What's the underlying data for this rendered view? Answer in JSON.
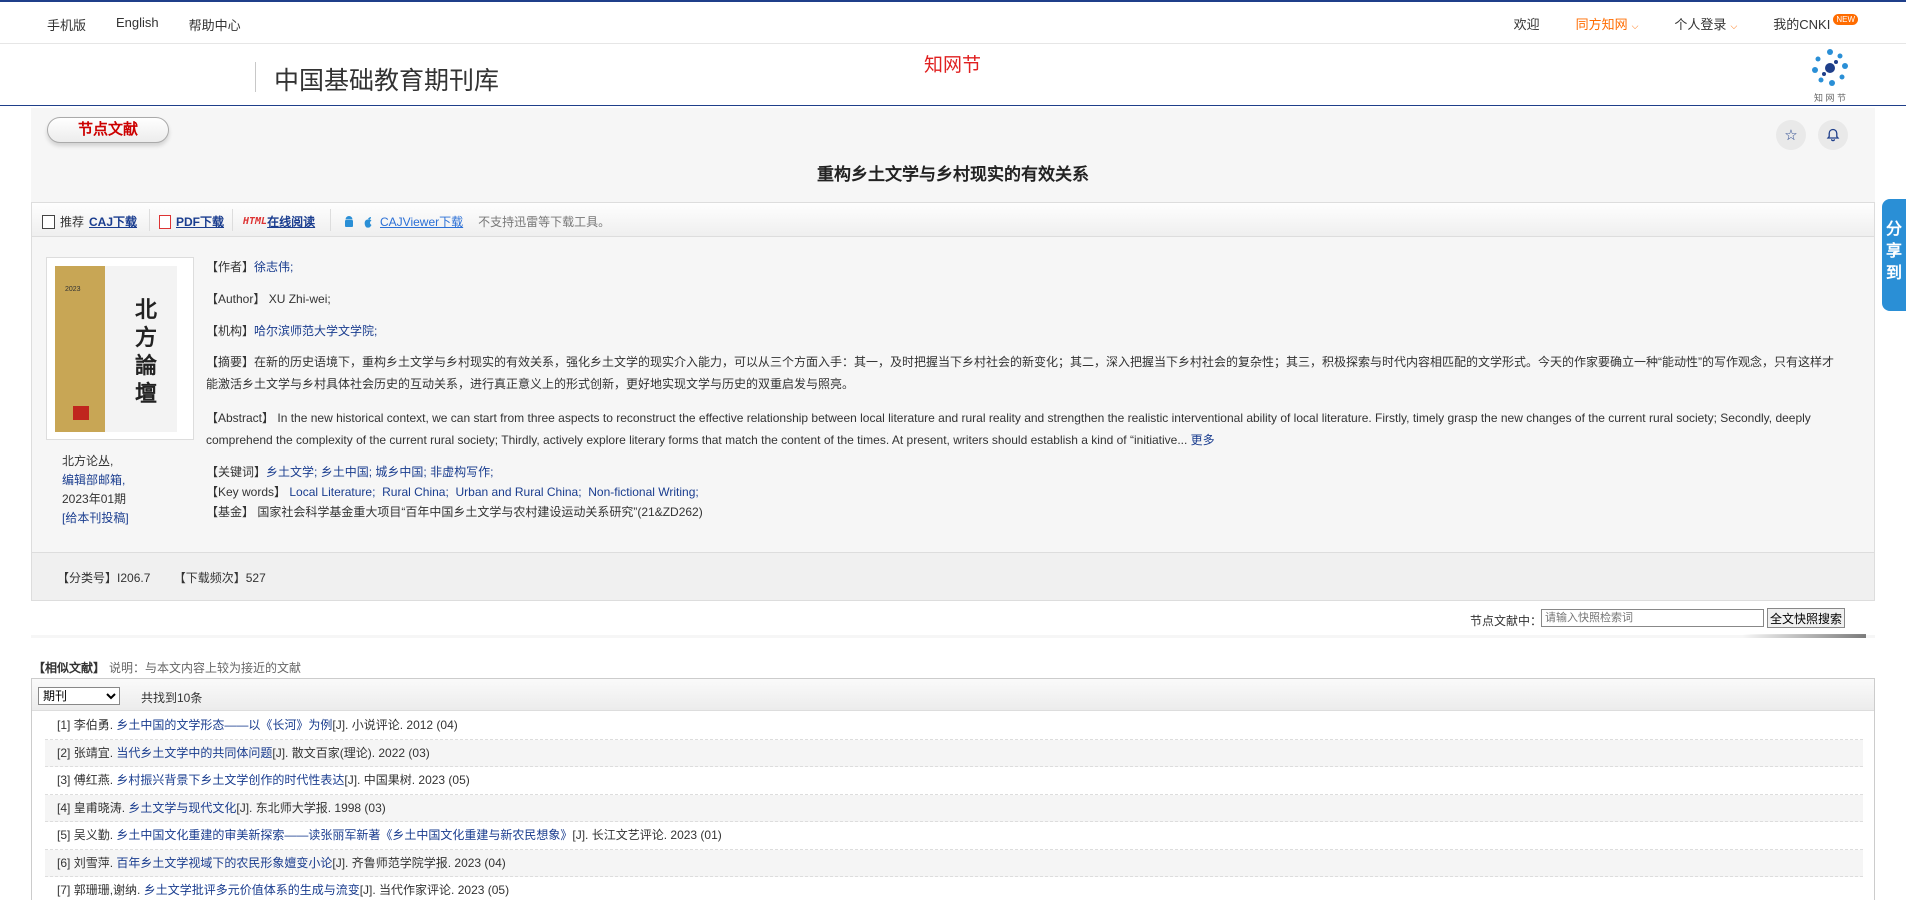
{
  "topbar": {
    "left_links": [
      "手机版",
      "English",
      "帮助中心"
    ],
    "welcome": "欢迎",
    "tongfang": "同方知网",
    "login": "个人登录",
    "mycnki": "我的CNKI",
    "new_badge": "NEW"
  },
  "header": {
    "title": "中国基础教育期刊库",
    "festival": "知网节",
    "logo_caption": "知 网 节"
  },
  "badge": "节点文献",
  "article": {
    "title": "重构乡土文学与乡村现实的有效关系"
  },
  "download_bar": {
    "recommend": "推荐",
    "caj": "CAJ下载",
    "pdf": "PDF下载",
    "html_icon": "HTML",
    "online": "在线阅读",
    "viewer": "CAJViewer下载",
    "note": "不支持迅雷等下载工具。"
  },
  "cover": {
    "year": "2023",
    "magazine": "北方論壇"
  },
  "journal": {
    "name": "北方论丛,",
    "email": "编辑部邮箱,",
    "issue": "2023年01期",
    "submit": "[给本刊投稿]"
  },
  "fields": {
    "author_label": "【作者】",
    "author": "徐志伟;",
    "author_en_label": "【Author】",
    "author_en": "XU Zhi-wei;",
    "org_label": "【机构】",
    "org": "哈尔滨师范大学文学院;",
    "abstract_label": "【摘要】",
    "abstract": "在新的历史语境下，重构乡土文学与乡村现实的有效关系，强化乡土文学的现实介入能力，可以从三个方面入手：其一，及时把握当下乡村社会的新变化；其二，深入把握当下乡村社会的复杂性；其三，积极探索与时代内容相匹配的文学形式。今天的作家要确立一种“能动性”的写作观念，只有这样才能激活乡土文学与乡村具体社会历史的互动关系，进行真正意义上的形式创新，更好地实现文学与历史的双重启发与照亮。",
    "abstract_en_label": "【Abstract】",
    "abstract_en": "In the new historical context, we can start from three aspects to reconstruct the effective relationship between local literature and rural reality and strengthen the realistic interventional ability of local literature. Firstly, timely grasp the new changes of the current rural society; Secondly, deeply comprehend the complexity of the current rural society; Thirdly, actively explore literary forms that match the content of the times. At present, writers should establish a kind of “initiative...",
    "more": "更多",
    "keywords_label": "【关键词】",
    "keywords": [
      "乡土文学;",
      "乡土中国;",
      "城乡中国;",
      "非虚构写作;"
    ],
    "keywords_en_label": "【Key words】",
    "keywords_en": [
      "Local Literature;",
      "Rural China;",
      "Urban and Rural China;",
      "Non-fictional Writing;"
    ],
    "fund_label": "【基金】",
    "fund": "国家社会科学基金重大项目“百年中国乡土文学与农村建设运动关系研究”(21&ZD262)"
  },
  "meta": {
    "class_label": "【分类号】",
    "class_value": "I206.7",
    "dl_label": "【下载频次】",
    "dl_value": "527"
  },
  "search": {
    "label": "节点文献中：",
    "placeholder": "请输入快照检索词",
    "button": "全文快照搜索"
  },
  "similar": {
    "heading": "【相似文献】",
    "desc": "说明：与本文内容上较为接近的文献",
    "select": "期刊",
    "count": "共找到10条",
    "rows": [
      {
        "num": "[1]",
        "author": "李伯勇.",
        "title": "乡土中国的文学形态——以《长河》为例",
        "rest": "[J]. 小说评论. 2012 (04)"
      },
      {
        "num": "[2]",
        "author": "张靖宜.",
        "title": "当代乡土文学中的共同体问题",
        "rest": "[J]. 散文百家(理论). 2022 (03)"
      },
      {
        "num": "[3]",
        "author": "傅红燕.",
        "title": "乡村振兴背景下乡土文学创作的时代性表达",
        "rest": "[J]. 中国果树. 2023 (05)"
      },
      {
        "num": "[4]",
        "author": "皇甫晓涛.",
        "title": "乡土文学与现代文化",
        "rest": "[J]. 东北师大学报. 1998 (03)"
      },
      {
        "num": "[5]",
        "author": "吴义勤.",
        "title": "乡土中国文化重建的审美新探索——读张丽军新著《乡土中国文化重建与新农民想象》",
        "rest": "[J]. 长江文艺评论. 2023 (01)"
      },
      {
        "num": "[6]",
        "author": "刘雪萍.",
        "title": "百年乡土文学视域下的农民形象嬗变小论",
        "rest": "[J]. 齐鲁师范学院学报. 2023 (04)"
      },
      {
        "num": "[7]",
        "author": "郭珊珊,谢纳.",
        "title": "乡土文学批评多元价值体系的生成与流变",
        "rest": "[J]. 当代作家评论. 2023 (05)"
      }
    ]
  },
  "share": "分享到",
  "colors": {
    "accent": "#1f3f8a",
    "orange": "#ff6c00",
    "red": "#e02020",
    "link": "#1a3d8f",
    "share": "#2a8fd6"
  }
}
